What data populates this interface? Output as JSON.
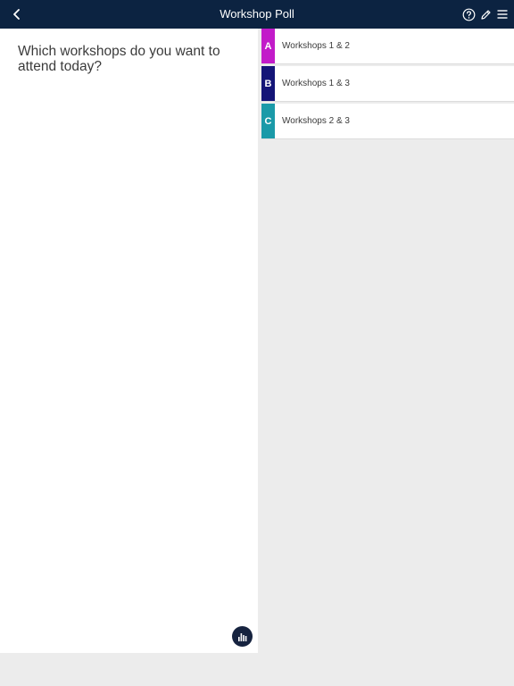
{
  "header": {
    "title": "Workshop Poll",
    "back_icon": "chevron-left-icon",
    "icons": [
      "help-icon",
      "pencil-icon",
      "menu-icon"
    ],
    "background": "#0c2341"
  },
  "question": {
    "text": "Which workshops do you want to attend today?"
  },
  "options": [
    {
      "letter": "A",
      "label": "Workshops 1 & 2",
      "color": "#c21bc9"
    },
    {
      "letter": "B",
      "label": "Workshops 1 & 3",
      "color": "#141577"
    },
    {
      "letter": "C",
      "label": "Workshops 2 & 3",
      "color": "#1a9aa8"
    }
  ],
  "results_button": {
    "icon": "bar-chart-icon",
    "color": "#16233f"
  }
}
